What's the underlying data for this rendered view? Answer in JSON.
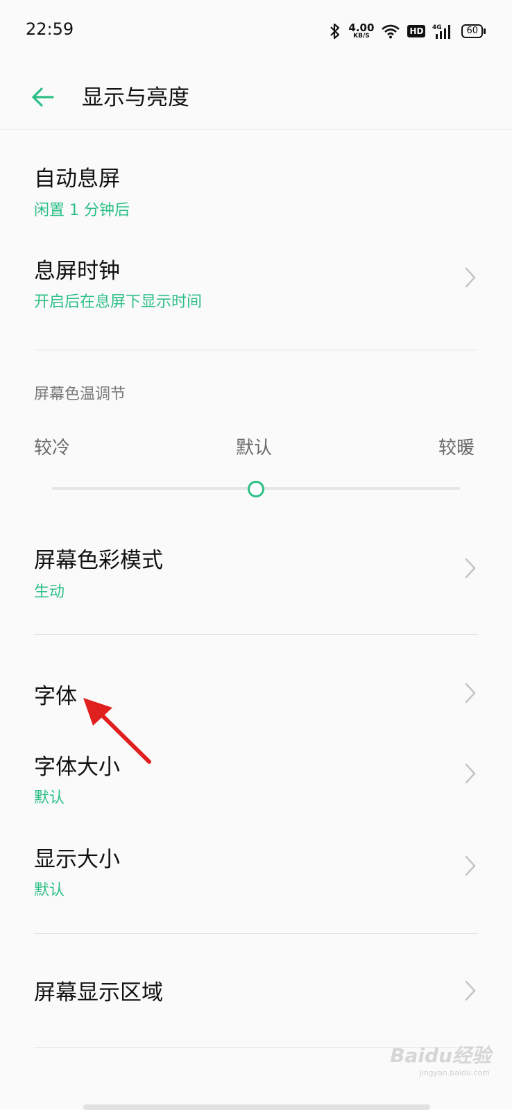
{
  "status": {
    "time": "22:59",
    "speed_value": "4.00",
    "speed_unit": "KB/S",
    "hd": "HD",
    "network": "4G",
    "battery": "60"
  },
  "header": {
    "title": "显示与亮度"
  },
  "items": {
    "auto_sleep": {
      "title": "自动息屏",
      "subtitle": "闲置 1 分钟后"
    },
    "aod_clock": {
      "title": "息屏时钟",
      "subtitle": "开启后在息屏下显示时间"
    },
    "color_temp": {
      "section": "屏幕色温调节",
      "left": "较冷",
      "center": "默认",
      "right": "较暖",
      "level": 0.5
    },
    "color_mode": {
      "title": "屏幕色彩模式",
      "subtitle": "生动"
    },
    "font": {
      "title": "字体"
    },
    "font_size": {
      "title": "字体大小",
      "subtitle": "默认"
    },
    "display_size": {
      "title": "显示大小",
      "subtitle": "默认"
    },
    "screen_area": {
      "title": "屏幕显示区域"
    }
  },
  "watermark": {
    "brand": "Baidu经验",
    "site": "jingyan.baidu.com"
  },
  "colors": {
    "accent": "#2bbf85",
    "annotation_arrow": "#e01f1f"
  },
  "icons": [
    "back-arrow-icon",
    "bluetooth-icon",
    "wifi-icon",
    "signal-icon",
    "battery-icon",
    "chevron-right-icon"
  ]
}
